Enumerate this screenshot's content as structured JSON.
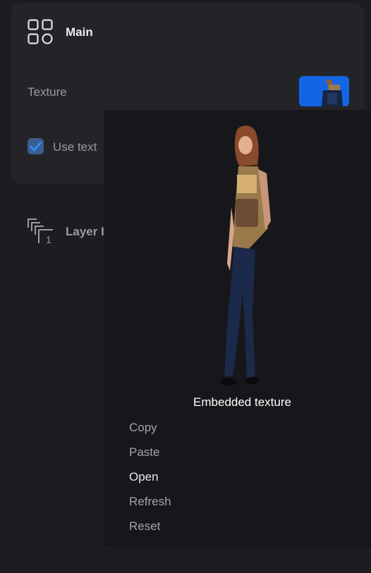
{
  "main": {
    "title": "Main",
    "texture_label": "Texture",
    "use_texture_label": "Use text",
    "use_texture_checked": true
  },
  "layer": {
    "label": "Layer I",
    "badge": "1"
  },
  "popup": {
    "title": "Embedded texture",
    "menu": [
      {
        "label": "Copy",
        "enabled": false
      },
      {
        "label": "Paste",
        "enabled": false
      },
      {
        "label": "Open",
        "enabled": true
      },
      {
        "label": "Refresh",
        "enabled": false
      },
      {
        "label": "Reset",
        "enabled": false
      }
    ]
  },
  "colors": {
    "background": "#1d1d21",
    "panel": "#242428",
    "popup": "#17171b",
    "accent": "#1266e6",
    "checkbox": "#3c5c8e"
  },
  "icons": {
    "main": "grid-icon",
    "layer": "layers-icon",
    "check": "checkmark-icon"
  }
}
